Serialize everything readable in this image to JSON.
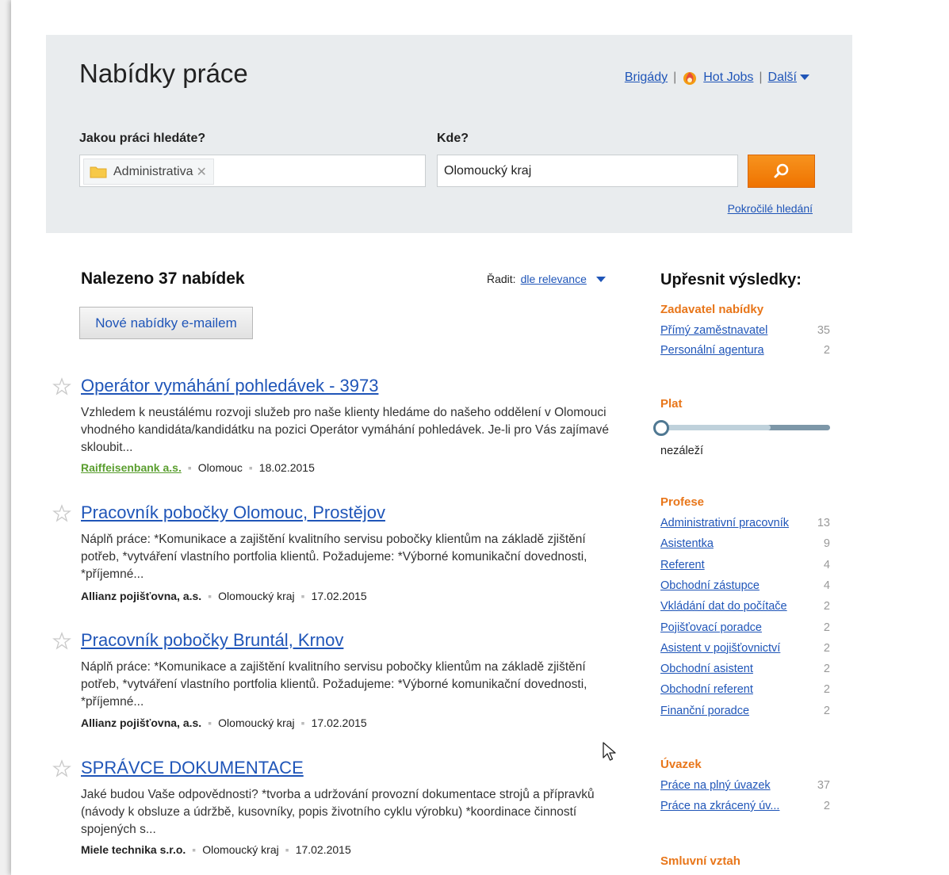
{
  "header": {
    "title": "Nabídky práce",
    "links": {
      "brigady": "Brigády",
      "hotjobs": "Hot Jobs",
      "dalsi": "Další",
      "separator": "|"
    }
  },
  "search": {
    "what_label": "Jakou práci hledáte?",
    "what_tag": "Administrativa",
    "where_label": "Kde?",
    "where_value": "Olomoucký kraj",
    "advanced_link": "Pokročilé hledání"
  },
  "results": {
    "count_text": "Nalezeno 37 nabídek",
    "sort_label": "Řadit:",
    "sort_value": "dle relevance",
    "email_button": "Nové nabídky e-mailem",
    "jobs": [
      {
        "title": "Operátor vymáhání pohledávek - 3973",
        "description": "Vzhledem k neustálému rozvoji služeb pro naše klienty hledáme do našeho oddělení v Olomouci vhodného kandidáta/kandidátku na pozici Operátor vymáhání pohledávek. Je-li pro Vás zajímavé skloubit...",
        "company": "Raiffeisenbank a.s.",
        "location": "Olomouc",
        "date": "18.02.2015"
      },
      {
        "title": "Pracovník pobočky Olomouc, Prostějov",
        "description": "Náplň práce: *Komunikace a zajištění kvalitního servisu pobočky klientům na základě zjištění potřeb, *vytváření vlastního portfolia klientů. Požadujeme: *Výborné komunikační dovednosti, *příjemné...",
        "company": "Allianz pojišťovna, a.s.",
        "location": "Olomoucký kraj",
        "date": "17.02.2015"
      },
      {
        "title": "Pracovník pobočky Bruntál, Krnov",
        "description": "Náplň práce: *Komunikace a zajištění kvalitního servisu pobočky klientům na základě zjištění potřeb, *vytváření vlastního portfolia klientů. Požadujeme: *Výborné komunikační dovednosti, *příjemné...",
        "company": "Allianz pojišťovna, a.s.",
        "location": "Olomoucký kraj",
        "date": "17.02.2015"
      },
      {
        "title": "SPRÁVCE DOKUMENTACE",
        "description": "Jaké budou Vaše odpovědnosti? *tvorba a udržování provozní dokumentace strojů a přípravků (návody k obsluze a údržbě, kusovníky, popis životního cyklu výrobku) *koordinace činností spojených s...",
        "company": "Miele technika s.r.o.",
        "location": "Olomoucký kraj",
        "date": "17.02.2015"
      }
    ]
  },
  "sidebar": {
    "title": "Upřesnit výsledky:",
    "zadavatel": {
      "heading": "Zadavatel nabídky",
      "items": [
        {
          "label": "Přímý zaměstnavatel",
          "count": "35"
        },
        {
          "label": "Personální agentura",
          "count": "2"
        }
      ]
    },
    "plat": {
      "heading": "Plat",
      "value": "nezáleží",
      "level": 0
    },
    "profese": {
      "heading": "Profese",
      "items": [
        {
          "label": "Administrativní pracovník",
          "count": "13"
        },
        {
          "label": "Asistentka",
          "count": "9"
        },
        {
          "label": "Referent",
          "count": "4"
        },
        {
          "label": "Obchodní zástupce",
          "count": "4"
        },
        {
          "label": "Vkládání dat do počítače",
          "count": "2"
        },
        {
          "label": "Pojišťovací poradce",
          "count": "2"
        },
        {
          "label": "Asistent v pojišťovnictví",
          "count": "2"
        },
        {
          "label": "Obchodní asistent",
          "count": "2"
        },
        {
          "label": "Obchodní referent",
          "count": "2"
        },
        {
          "label": "Finanční poradce",
          "count": "2"
        }
      ]
    },
    "uvazek": {
      "heading": "Úvazek",
      "items": [
        {
          "label": "Práce na plný úvazek",
          "count": "37"
        },
        {
          "label": "Práce na zkrácený úv...",
          "count": "2"
        }
      ]
    },
    "smluvni": {
      "heading": "Smluvní vztah"
    }
  },
  "colors": {
    "accent_orange": "#f7931e",
    "link_blue": "#1f55b8",
    "facet_orange": "#e8761a",
    "panel_bg": "#e9ecee"
  },
  "icons": {
    "search_button": "search-icon",
    "tag": "folder-icon",
    "star": "star-icon",
    "hot": "fire-icon"
  }
}
